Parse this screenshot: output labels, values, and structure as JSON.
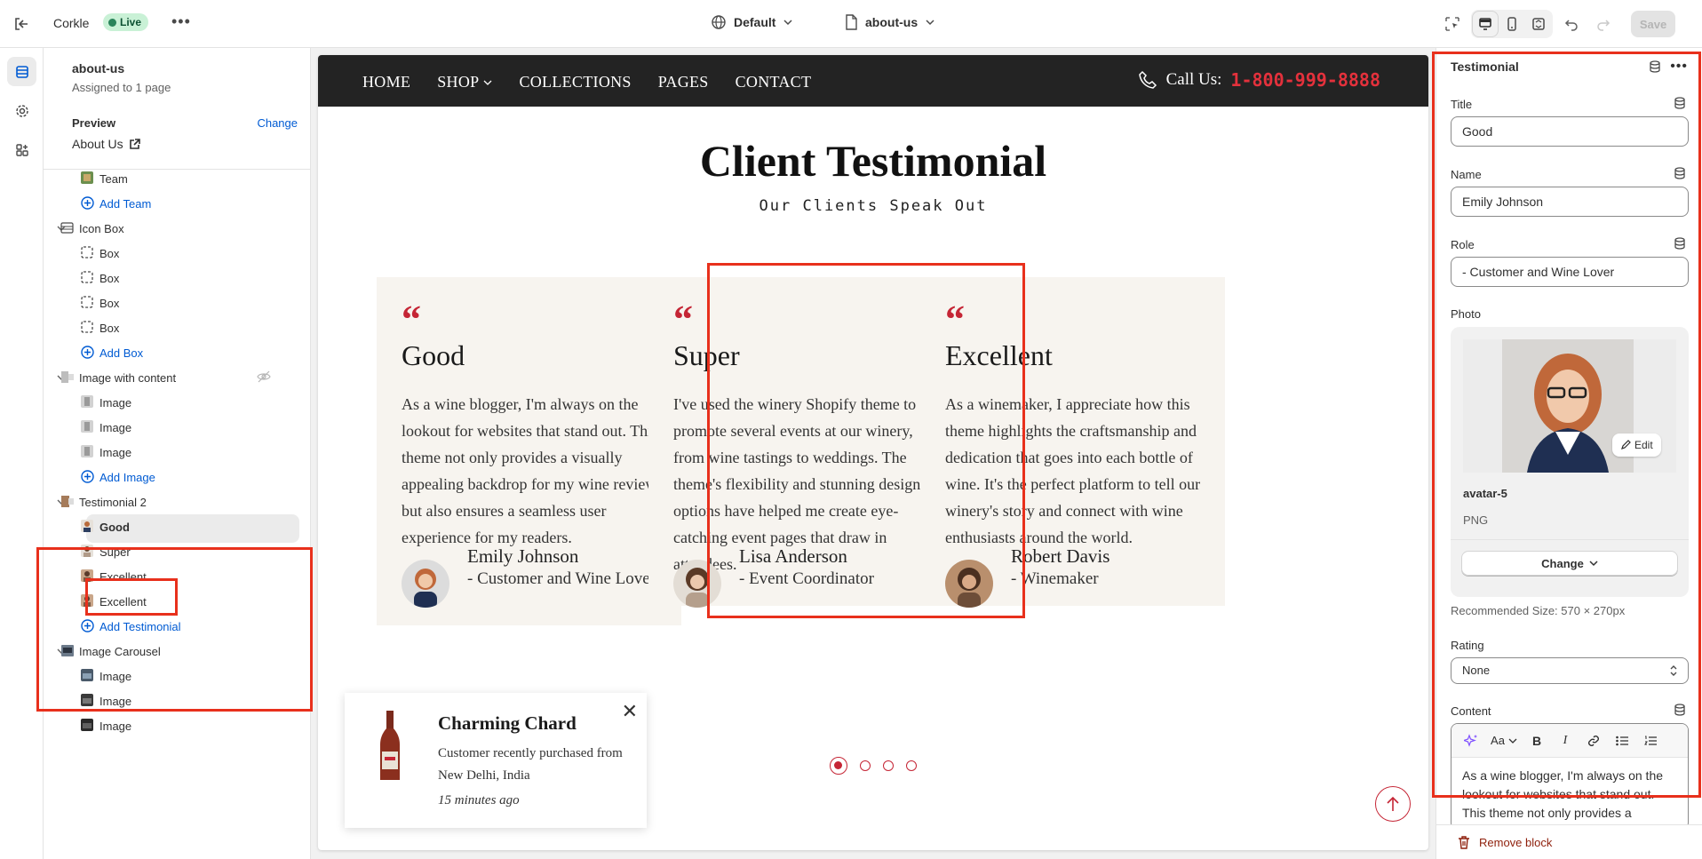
{
  "topbar": {
    "store_name": "Corkle",
    "status": "Live",
    "theme_label": "Default",
    "template_label": "about-us",
    "save_label": "Save"
  },
  "sidebar": {
    "template_title": "about-us",
    "assigned": "Assigned to 1 page",
    "preview_label": "Preview",
    "change_label": "Change",
    "preview_page": "About Us",
    "tree": [
      {
        "label": "Team",
        "type": "child"
      },
      {
        "label": "Add Team",
        "type": "add"
      },
      {
        "label": "Icon Box",
        "type": "section"
      },
      {
        "label": "Box",
        "type": "child"
      },
      {
        "label": "Box",
        "type": "child"
      },
      {
        "label": "Box",
        "type": "child"
      },
      {
        "label": "Box",
        "type": "child"
      },
      {
        "label": "Add Box",
        "type": "add"
      },
      {
        "label": "Image with content",
        "type": "section"
      },
      {
        "label": "Image",
        "type": "child"
      },
      {
        "label": "Image",
        "type": "child"
      },
      {
        "label": "Image",
        "type": "child"
      },
      {
        "label": "Add Image",
        "type": "add"
      },
      {
        "label": "Testimonial 2",
        "type": "section"
      },
      {
        "label": "Good",
        "type": "child",
        "selected": true
      },
      {
        "label": "Super",
        "type": "child"
      },
      {
        "label": "Excellent",
        "type": "child"
      },
      {
        "label": "Excellent",
        "type": "child"
      },
      {
        "label": "Add Testimonial",
        "type": "add"
      },
      {
        "label": "Image Carousel",
        "type": "section"
      },
      {
        "label": "Image",
        "type": "child"
      },
      {
        "label": "Image",
        "type": "child"
      },
      {
        "label": "Image",
        "type": "child"
      }
    ]
  },
  "preview": {
    "nav": [
      "HOME",
      "SHOP",
      "COLLECTIONS",
      "PAGES",
      "CONTACT"
    ],
    "call_label": "Call Us:",
    "call_number": "1-800-999-8888",
    "title": "Client Testimonial",
    "subtitle": "Our Clients Speak Out",
    "quote_mark": "“",
    "cards": [
      {
        "title": "Good",
        "body": "As a wine blogger, I'm always on the lookout for websites that stand out. This theme not only provides a visually appealing backdrop for my wine reviews but also ensures a seamless user experience for my readers.",
        "name": "Emily Johnson",
        "role": "- Customer and Wine Lover"
      },
      {
        "title": "Super",
        "body": "I've used the winery Shopify theme to promote several events at our winery, from wine tastings to weddings. The theme's flexibility and stunning design options have helped me create eye-catching event pages that draw in attendees.",
        "name": "Lisa Anderson",
        "role": "- Event Coordinator"
      },
      {
        "title": "Excellent",
        "body": "As a winemaker, I appreciate how this theme highlights the craftsmanship and dedication that goes into each bottle of wine. It's the perfect platform to tell our winery's story and connect with wine enthusiasts around the world.",
        "name": "Robert Davis",
        "role": "- Winemaker"
      }
    ],
    "toast": {
      "product": "Charming Chard",
      "message": "Customer recently purchased from New Delhi, India",
      "time": "15 minutes ago"
    }
  },
  "settings": {
    "block_title": "Testimonial",
    "title_label": "Title",
    "title_value": "Good",
    "name_label": "Name",
    "name_value": "Emily Johnson",
    "role_label": "Role",
    "role_value": "- Customer and Wine Lover",
    "photo_label": "Photo",
    "photo_edit": "Edit",
    "photo_filename": "avatar-5",
    "photo_type": "PNG",
    "photo_change": "Change",
    "recommended": "Recommended Size: 570 × 270px",
    "rating_label": "Rating",
    "rating_value": "None",
    "content_label": "Content",
    "content_value": "As a wine blogger, I'm always on the lookout for websites that stand out. This theme not only provides a",
    "remove_label": "Remove block"
  },
  "colors": {
    "accent_red": "#c52535",
    "highlight": "#e8301c",
    "link_blue": "#005bd3",
    "nav_bg": "#232323"
  }
}
